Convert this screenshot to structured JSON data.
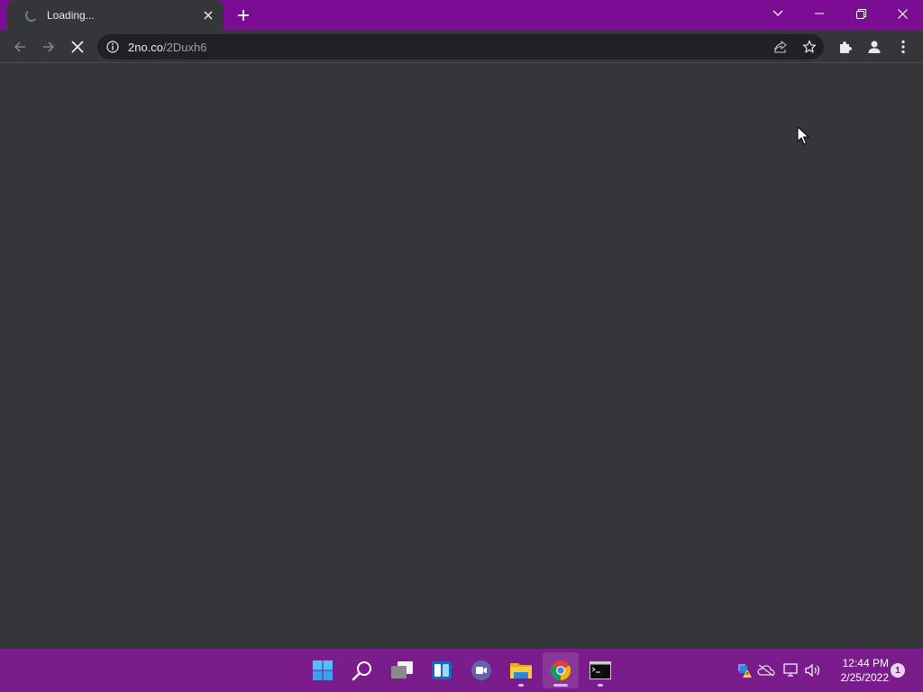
{
  "browser": {
    "tab": {
      "title": "Loading...",
      "state": "loading"
    },
    "address_bar": {
      "domain": "2no.co",
      "path": "/2Duxh6"
    },
    "icons": {
      "back": "arrow-left-icon",
      "forward": "arrow-right-icon",
      "stop": "stop-loading-icon",
      "site_info": "info-icon",
      "share": "share-icon",
      "bookmark": "star-icon",
      "extensions": "puzzle-icon",
      "profile": "person-icon",
      "menu": "kebab-menu-icon"
    }
  },
  "taskbar": {
    "apps": [
      "start",
      "search",
      "task-view",
      "widgets",
      "teams-chat",
      "file-explorer",
      "chrome",
      "terminal"
    ],
    "clock": {
      "time": "12:44 PM",
      "date": "2/25/2022"
    },
    "notifications": "1"
  },
  "colors": {
    "frame": "#7a0d93",
    "taskbar": "#7a1c8c",
    "content_bg": "#35363a",
    "omnibox_bg": "#202124"
  }
}
